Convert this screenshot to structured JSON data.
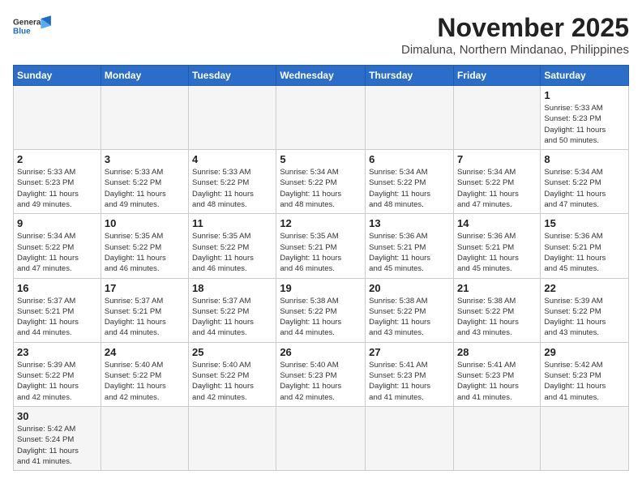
{
  "header": {
    "logo_line1": "General",
    "logo_line2": "Blue",
    "month": "November 2025",
    "location": "Dimaluna, Northern Mindanao, Philippines"
  },
  "weekdays": [
    "Sunday",
    "Monday",
    "Tuesday",
    "Wednesday",
    "Thursday",
    "Friday",
    "Saturday"
  ],
  "weeks": [
    [
      {
        "day": "",
        "info": ""
      },
      {
        "day": "",
        "info": ""
      },
      {
        "day": "",
        "info": ""
      },
      {
        "day": "",
        "info": ""
      },
      {
        "day": "",
        "info": ""
      },
      {
        "day": "",
        "info": ""
      },
      {
        "day": "1",
        "info": "Sunrise: 5:33 AM\nSunset: 5:23 PM\nDaylight: 11 hours\nand 50 minutes."
      }
    ],
    [
      {
        "day": "2",
        "info": "Sunrise: 5:33 AM\nSunset: 5:23 PM\nDaylight: 11 hours\nand 49 minutes."
      },
      {
        "day": "3",
        "info": "Sunrise: 5:33 AM\nSunset: 5:22 PM\nDaylight: 11 hours\nand 49 minutes."
      },
      {
        "day": "4",
        "info": "Sunrise: 5:33 AM\nSunset: 5:22 PM\nDaylight: 11 hours\nand 48 minutes."
      },
      {
        "day": "5",
        "info": "Sunrise: 5:34 AM\nSunset: 5:22 PM\nDaylight: 11 hours\nand 48 minutes."
      },
      {
        "day": "6",
        "info": "Sunrise: 5:34 AM\nSunset: 5:22 PM\nDaylight: 11 hours\nand 48 minutes."
      },
      {
        "day": "7",
        "info": "Sunrise: 5:34 AM\nSunset: 5:22 PM\nDaylight: 11 hours\nand 47 minutes."
      },
      {
        "day": "8",
        "info": "Sunrise: 5:34 AM\nSunset: 5:22 PM\nDaylight: 11 hours\nand 47 minutes."
      }
    ],
    [
      {
        "day": "9",
        "info": "Sunrise: 5:34 AM\nSunset: 5:22 PM\nDaylight: 11 hours\nand 47 minutes."
      },
      {
        "day": "10",
        "info": "Sunrise: 5:35 AM\nSunset: 5:22 PM\nDaylight: 11 hours\nand 46 minutes."
      },
      {
        "day": "11",
        "info": "Sunrise: 5:35 AM\nSunset: 5:22 PM\nDaylight: 11 hours\nand 46 minutes."
      },
      {
        "day": "12",
        "info": "Sunrise: 5:35 AM\nSunset: 5:21 PM\nDaylight: 11 hours\nand 46 minutes."
      },
      {
        "day": "13",
        "info": "Sunrise: 5:36 AM\nSunset: 5:21 PM\nDaylight: 11 hours\nand 45 minutes."
      },
      {
        "day": "14",
        "info": "Sunrise: 5:36 AM\nSunset: 5:21 PM\nDaylight: 11 hours\nand 45 minutes."
      },
      {
        "day": "15",
        "info": "Sunrise: 5:36 AM\nSunset: 5:21 PM\nDaylight: 11 hours\nand 45 minutes."
      }
    ],
    [
      {
        "day": "16",
        "info": "Sunrise: 5:37 AM\nSunset: 5:21 PM\nDaylight: 11 hours\nand 44 minutes."
      },
      {
        "day": "17",
        "info": "Sunrise: 5:37 AM\nSunset: 5:21 PM\nDaylight: 11 hours\nand 44 minutes."
      },
      {
        "day": "18",
        "info": "Sunrise: 5:37 AM\nSunset: 5:22 PM\nDaylight: 11 hours\nand 44 minutes."
      },
      {
        "day": "19",
        "info": "Sunrise: 5:38 AM\nSunset: 5:22 PM\nDaylight: 11 hours\nand 44 minutes."
      },
      {
        "day": "20",
        "info": "Sunrise: 5:38 AM\nSunset: 5:22 PM\nDaylight: 11 hours\nand 43 minutes."
      },
      {
        "day": "21",
        "info": "Sunrise: 5:38 AM\nSunset: 5:22 PM\nDaylight: 11 hours\nand 43 minutes."
      },
      {
        "day": "22",
        "info": "Sunrise: 5:39 AM\nSunset: 5:22 PM\nDaylight: 11 hours\nand 43 minutes."
      }
    ],
    [
      {
        "day": "23",
        "info": "Sunrise: 5:39 AM\nSunset: 5:22 PM\nDaylight: 11 hours\nand 42 minutes."
      },
      {
        "day": "24",
        "info": "Sunrise: 5:40 AM\nSunset: 5:22 PM\nDaylight: 11 hours\nand 42 minutes."
      },
      {
        "day": "25",
        "info": "Sunrise: 5:40 AM\nSunset: 5:22 PM\nDaylight: 11 hours\nand 42 minutes."
      },
      {
        "day": "26",
        "info": "Sunrise: 5:40 AM\nSunset: 5:23 PM\nDaylight: 11 hours\nand 42 minutes."
      },
      {
        "day": "27",
        "info": "Sunrise: 5:41 AM\nSunset: 5:23 PM\nDaylight: 11 hours\nand 41 minutes."
      },
      {
        "day": "28",
        "info": "Sunrise: 5:41 AM\nSunset: 5:23 PM\nDaylight: 11 hours\nand 41 minutes."
      },
      {
        "day": "29",
        "info": "Sunrise: 5:42 AM\nSunset: 5:23 PM\nDaylight: 11 hours\nand 41 minutes."
      }
    ],
    [
      {
        "day": "30",
        "info": "Sunrise: 5:42 AM\nSunset: 5:24 PM\nDaylight: 11 hours\nand 41 minutes."
      },
      {
        "day": "",
        "info": ""
      },
      {
        "day": "",
        "info": ""
      },
      {
        "day": "",
        "info": ""
      },
      {
        "day": "",
        "info": ""
      },
      {
        "day": "",
        "info": ""
      },
      {
        "day": "",
        "info": ""
      }
    ]
  ]
}
